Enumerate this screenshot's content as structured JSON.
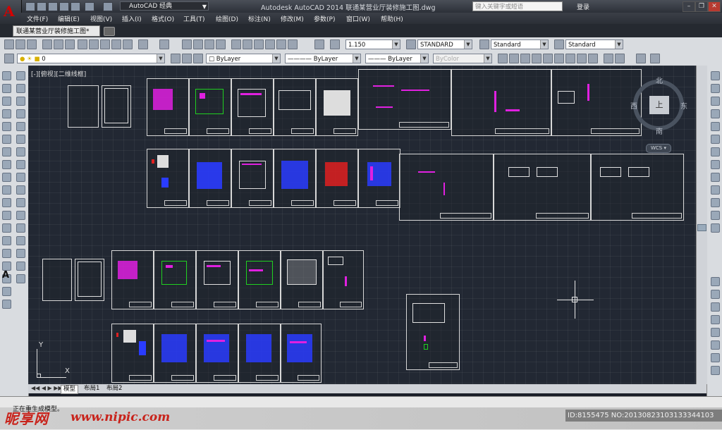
{
  "app": {
    "workspace": "AutoCAD 经典",
    "title": "Autodesk AutoCAD 2014    联通某营业厅装修施工图.dwg",
    "search_placeholder": "键入关键字或短语",
    "login": "登录"
  },
  "menus": [
    "文件(F)",
    "编辑(E)",
    "视图(V)",
    "插入(I)",
    "格式(O)",
    "工具(T)",
    "绘图(D)",
    "标注(N)",
    "修改(M)",
    "参数(P)",
    "窗口(W)",
    "帮助(H)"
  ],
  "document_tab": "联通某营业厅装修施工图*",
  "toolbar1": {
    "scale": "1.150",
    "text_style": "STANDARD",
    "dim_style": "Standard",
    "table_style": "Standard"
  },
  "toolbar2": {
    "layer": "0",
    "color": "ByLayer",
    "linetype": "ByLayer",
    "lineweight": "ByLayer",
    "plotstyle": "ByColor"
  },
  "viewport_label": "[-][俯视][二维线框]",
  "viewcube": {
    "north": "北",
    "south": "南",
    "east": "东",
    "west": "西",
    "top": "上",
    "wcs": "WCS"
  },
  "ucs": {
    "x": "X",
    "y": "Y"
  },
  "layout_tabs": [
    "模型",
    "布局1",
    "布局2"
  ],
  "command_text": "正在重生成模型。",
  "watermark": {
    "logo": "昵享网",
    "url": "www.nipic.com",
    "id": "ID:8155475 NO:20130823103133344103"
  },
  "colors": {
    "magenta": "#e020e0",
    "blue": "#2a3cff",
    "canvas": "#222833",
    "red": "#e02020",
    "green": "#20d020"
  }
}
